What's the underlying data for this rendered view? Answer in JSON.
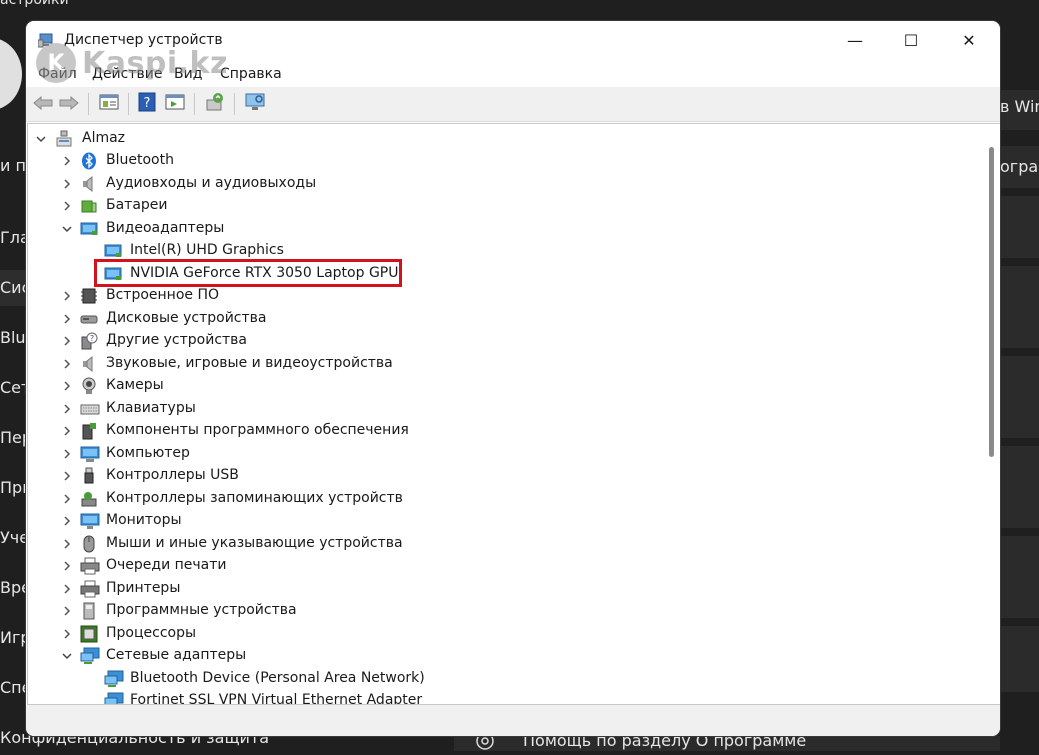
{
  "background": {
    "top_left_text": "астройки",
    "right_texts": [
      "в Win",
      "ограм"
    ],
    "left_items": [
      "и п",
      "Гла",
      "Сис",
      "Blu",
      "Сет",
      "Пер",
      "При",
      "Уче",
      "Вре",
      "Игр",
      "Спе"
    ],
    "bottom_left": "Конфиденциальность и защита",
    "bottom_right": "Помощь по разделу О программе"
  },
  "window": {
    "title": "Диспетчер устройств",
    "controls": {
      "minimize": "—",
      "maximize": "☐",
      "close": "✕"
    }
  },
  "watermark": {
    "logo": "K",
    "text": "Kaspi.kz"
  },
  "menu": [
    "Файл",
    "Действие",
    "Вид",
    "Справка"
  ],
  "tree": {
    "root": "Almaz",
    "items": [
      {
        "label": "Bluetooth",
        "icon": "bluetooth-icon",
        "expanded": false
      },
      {
        "label": "Аудиовходы и аудиовыходы",
        "icon": "speaker-icon",
        "expanded": false
      },
      {
        "label": "Батареи",
        "icon": "battery-icon",
        "expanded": false
      },
      {
        "label": "Видеоадаптеры",
        "icon": "display-adapter-icon",
        "expanded": true
      },
      {
        "label": "Intel(R) UHD Graphics",
        "icon": "display-adapter-icon",
        "child": true
      },
      {
        "label": "NVIDIA GeForce RTX 3050 Laptop GPU",
        "icon": "display-adapter-icon",
        "child": true
      },
      {
        "label": "Встроенное ПО",
        "icon": "firmware-icon",
        "expanded": false
      },
      {
        "label": "Дисковые устройства",
        "icon": "disk-icon",
        "expanded": false
      },
      {
        "label": "Другие устройства",
        "icon": "unknown-device-icon",
        "expanded": false
      },
      {
        "label": "Звуковые, игровые и видеоустройства",
        "icon": "sound-icon",
        "expanded": false
      },
      {
        "label": "Камеры",
        "icon": "camera-icon",
        "expanded": false
      },
      {
        "label": "Клавиатуры",
        "icon": "keyboard-icon",
        "expanded": false
      },
      {
        "label": "Компоненты программного обеспечения",
        "icon": "software-component-icon",
        "expanded": false
      },
      {
        "label": "Компьютер",
        "icon": "computer-icon",
        "expanded": false
      },
      {
        "label": "Контроллеры USB",
        "icon": "usb-icon",
        "expanded": false
      },
      {
        "label": "Контроллеры запоминающих устройств",
        "icon": "storage-controller-icon",
        "expanded": false
      },
      {
        "label": "Мониторы",
        "icon": "monitor-icon",
        "expanded": false
      },
      {
        "label": "Мыши и иные указывающие устройства",
        "icon": "mouse-icon",
        "expanded": false
      },
      {
        "label": "Очереди печати",
        "icon": "print-queue-icon",
        "expanded": false
      },
      {
        "label": "Принтеры",
        "icon": "printer-icon",
        "expanded": false
      },
      {
        "label": "Программные устройства",
        "icon": "software-device-icon",
        "expanded": false
      },
      {
        "label": "Процессоры",
        "icon": "processor-icon",
        "expanded": false
      },
      {
        "label": "Сетевые адаптеры",
        "icon": "network-adapter-icon",
        "expanded": true
      },
      {
        "label": "Bluetooth Device (Personal Area Network)",
        "icon": "network-adapter-icon",
        "child": true
      },
      {
        "label": "Fortinet SSL VPN Virtual Ethernet Adapter",
        "icon": "network-adapter-icon",
        "child": true
      }
    ]
  },
  "colors": {
    "highlight": "#d4121b",
    "bluetooth": "#1e73d8",
    "adapter": "#3a8fd6"
  }
}
